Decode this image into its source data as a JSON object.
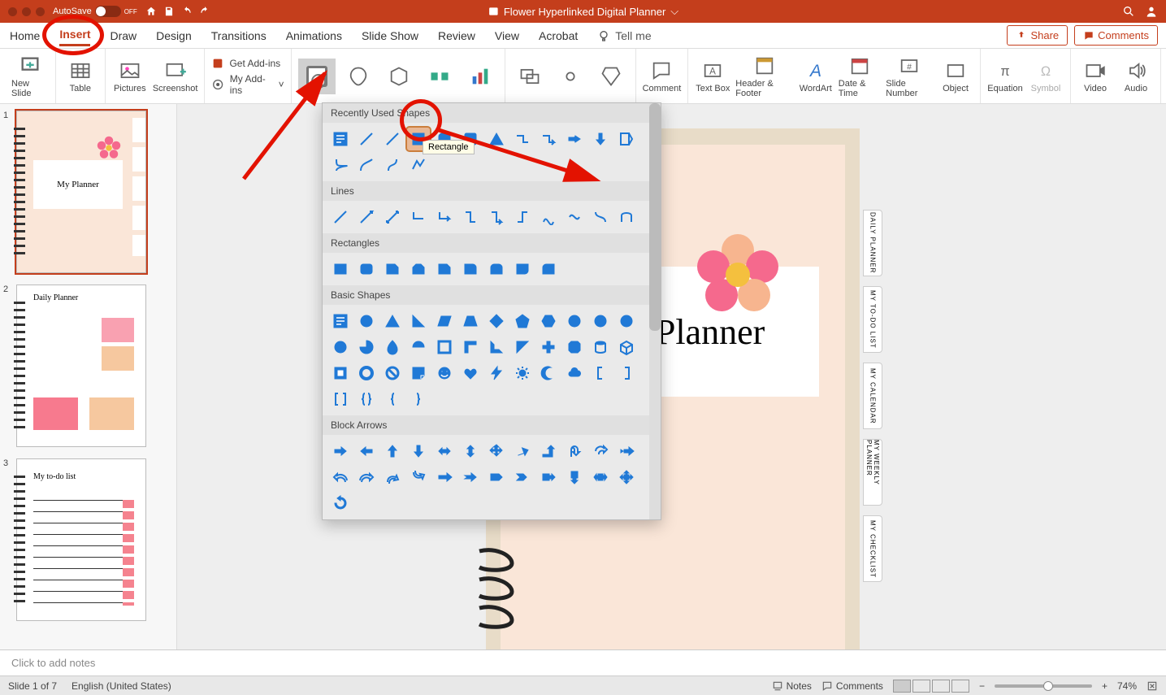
{
  "titlebar": {
    "autosave_label": "AutoSave",
    "autosave_state": "OFF",
    "document_title": "Flower Hyperlinked Digital Planner"
  },
  "tabs": [
    "Home",
    "Insert",
    "Draw",
    "Design",
    "Transitions",
    "Animations",
    "Slide Show",
    "Review",
    "View",
    "Acrobat"
  ],
  "active_tab": "Insert",
  "tell_me": "Tell me",
  "share_label": "Share",
  "comments_label": "Comments",
  "ribbon": {
    "new_slide": "New Slide",
    "table": "Table",
    "pictures": "Pictures",
    "screenshot": "Screenshot",
    "get_addins": "Get Add-ins",
    "my_addins": "My Add-ins",
    "comment": "Comment",
    "text_box": "Text Box",
    "header_footer": "Header & Footer",
    "word_art": "WordArt",
    "date_time": "Date & Time",
    "slide_number": "Slide Number",
    "object": "Object",
    "equation": "Equation",
    "symbol": "Symbol",
    "video": "Video",
    "audio": "Audio"
  },
  "shapes_panel": {
    "recently_used": "Recently Used Shapes",
    "lines": "Lines",
    "rectangles": "Rectangles",
    "basic_shapes": "Basic Shapes",
    "block_arrows": "Block Arrows",
    "tooltip": "Rectangle"
  },
  "slide_content": {
    "title": "My Planner",
    "tabs": [
      "DAILY PLANNER",
      "MY TO-DO LIST",
      "MY CALENDAR",
      "MY WEEKLY PLANNER",
      "MY CHECKLIST"
    ]
  },
  "thumbs": {
    "t1": "My Planner",
    "t2": "Daily Planner",
    "t3": "My to-do list"
  },
  "notes_placeholder": "Click to add notes",
  "status": {
    "slide_info": "Slide 1 of 7",
    "language": "English (United States)",
    "notes": "Notes",
    "comments": "Comments",
    "zoom": "74%"
  }
}
